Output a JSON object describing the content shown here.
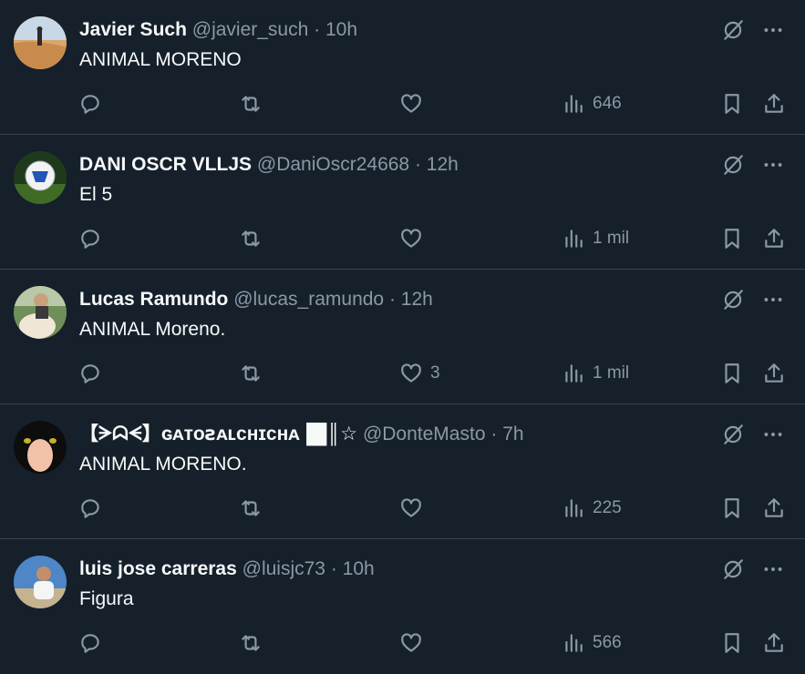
{
  "colors": {
    "background": "#15202b",
    "text": "#f7f9f9",
    "muted": "#8b98a5",
    "divider": "#38444d"
  },
  "icons": [
    "reply-icon",
    "retweet-icon",
    "like-icon",
    "views-icon",
    "bookmark-icon",
    "share-icon",
    "grok-icon",
    "more-icon"
  ],
  "tweets": [
    {
      "name": "Javier Such",
      "handle": "@javier_such",
      "sep": "·",
      "time": "10h",
      "text": "ANIMAL MORENO",
      "replies": "",
      "retweets": "",
      "likes": "",
      "views": "646"
    },
    {
      "name": "DANI OSCR VLLJS",
      "handle": "@DaniOscr24668",
      "sep": "·",
      "time": "12h",
      "text": "El 5",
      "replies": "",
      "retweets": "",
      "likes": "",
      "views": "1 mil"
    },
    {
      "name": "Lucas Ramundo",
      "handle": "@lucas_ramundo",
      "sep": "·",
      "time": "12h",
      "text": "ANIMAL Moreno.",
      "replies": "",
      "retweets": "",
      "likes": "3",
      "views": "1 mil"
    },
    {
      "name": "【ᗒᗣᗕ】ɢᴀᴛᴏꙅᴀʟᴄʜɪᴄʜᴀ▐█║☆",
      "handle": "@DonteMasto",
      "sep": "·",
      "time": "7h",
      "text": "ANIMAL MORENO.",
      "replies": "",
      "retweets": "",
      "likes": "",
      "views": "225"
    },
    {
      "name": "luis jose carreras",
      "handle": "@luisjc73",
      "sep": "·",
      "time": "10h",
      "text": "Figura",
      "replies": "",
      "retweets": "",
      "likes": "",
      "views": "566"
    }
  ]
}
